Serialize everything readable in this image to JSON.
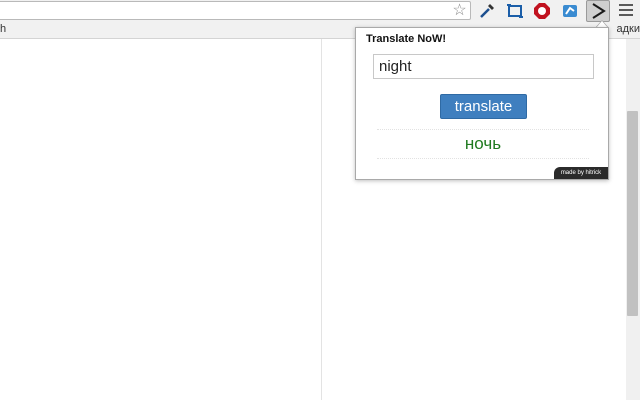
{
  "browser": {
    "omnibox_value": "",
    "icons": [
      "star-icon",
      "eyedropper-icon",
      "screenshot-icon",
      "adblock-icon",
      "extension-icon",
      "translate-extension-icon",
      "menu-icon"
    ],
    "colors": {
      "toolbar": "#f1f1f1",
      "active_extension": "#cfcfcf"
    }
  },
  "bookmarks": {
    "left_text": "h",
    "right_text": "адки"
  },
  "popup": {
    "title": "Translate NoW!",
    "input_value": "night",
    "button_label": "translate",
    "result": "ночь",
    "credit": "made by hitrick",
    "colors": {
      "button": "#3f7fbf",
      "result": "#1f7a1f"
    }
  }
}
